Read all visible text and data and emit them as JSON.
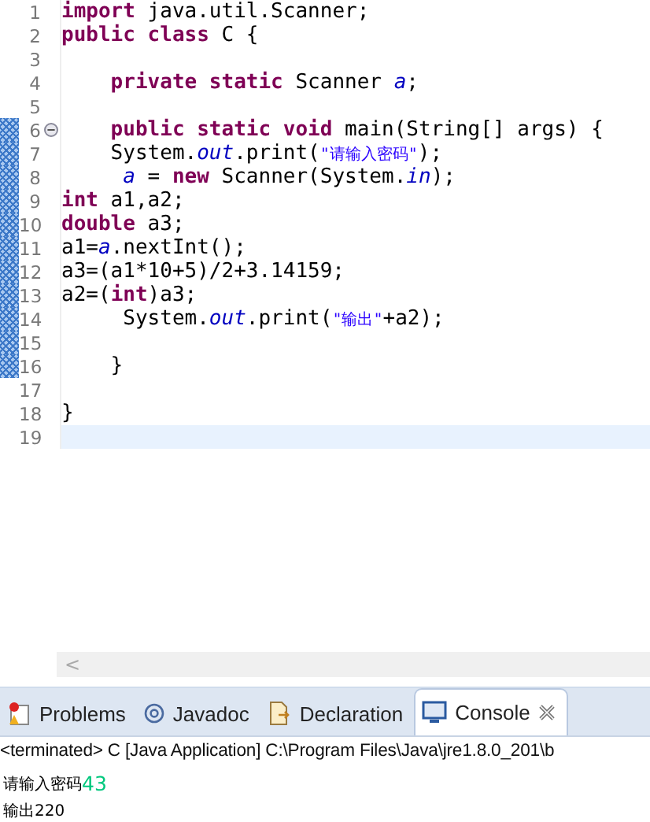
{
  "editor": {
    "lines": [
      {
        "number": "1",
        "marked": false,
        "foldable": false,
        "current": false,
        "tokens": [
          {
            "kind": "keyword",
            "text": "import"
          },
          {
            "kind": "plain",
            "text": " java.util.Scanner;"
          }
        ]
      },
      {
        "number": "2",
        "marked": false,
        "foldable": false,
        "current": false,
        "tokens": [
          {
            "kind": "keyword",
            "text": "public"
          },
          {
            "kind": "keyword",
            "text": " class"
          },
          {
            "kind": "plain",
            "text": " C {"
          }
        ]
      },
      {
        "number": "3",
        "marked": false,
        "foldable": false,
        "current": false
      },
      {
        "number": "4",
        "marked": false,
        "foldable": false,
        "current": false,
        "tokens": [
          {
            "kind": "keyword",
            "text": "    private"
          },
          {
            "kind": "keyword",
            "text": " static"
          },
          {
            "kind": "plain",
            "text": " Scanner "
          },
          {
            "kind": "field",
            "text": "a"
          },
          {
            "kind": "plain",
            "text": ";"
          }
        ]
      },
      {
        "number": "5",
        "marked": false,
        "foldable": false,
        "current": false
      },
      {
        "number": "6",
        "marked": true,
        "foldable": true,
        "current": false,
        "tokens": [
          {
            "kind": "keyword",
            "text": "    public"
          },
          {
            "kind": "keyword",
            "text": " static"
          },
          {
            "kind": "keyword",
            "text": " void"
          },
          {
            "kind": "plain",
            "text": " main(String[] args) {"
          }
        ]
      },
      {
        "number": "7",
        "marked": true,
        "foldable": false,
        "current": false,
        "tokens": [
          {
            "kind": "plain",
            "text": "    System."
          },
          {
            "kind": "field",
            "text": "out"
          },
          {
            "kind": "plain",
            "text": ".print("
          },
          {
            "kind": "string",
            "text": "\"请输入密码\""
          },
          {
            "kind": "plain",
            "text": ");"
          }
        ]
      },
      {
        "number": "8",
        "marked": true,
        "foldable": false,
        "current": false,
        "tokens": [
          {
            "kind": "field",
            "text": "     a"
          },
          {
            "kind": "plain",
            "text": " = "
          },
          {
            "kind": "keyword",
            "text": "new"
          },
          {
            "kind": "plain",
            "text": " Scanner(System."
          },
          {
            "kind": "field",
            "text": "in"
          },
          {
            "kind": "plain",
            "text": ");"
          }
        ]
      },
      {
        "number": "9",
        "marked": true,
        "foldable": false,
        "current": false,
        "tokens": [
          {
            "kind": "keyword",
            "text": "int"
          },
          {
            "kind": "plain",
            "text": " a1,a2;"
          }
        ]
      },
      {
        "number": "10",
        "marked": true,
        "foldable": false,
        "current": false,
        "tokens": [
          {
            "kind": "keyword",
            "text": "double"
          },
          {
            "kind": "plain",
            "text": " a3;"
          }
        ]
      },
      {
        "number": "11",
        "marked": true,
        "foldable": false,
        "current": false,
        "tokens": [
          {
            "kind": "plain",
            "text": "a1="
          },
          {
            "kind": "field",
            "text": "a"
          },
          {
            "kind": "plain",
            "text": ".nextInt();"
          }
        ]
      },
      {
        "number": "12",
        "marked": true,
        "foldable": false,
        "current": false,
        "tokens": [
          {
            "kind": "plain",
            "text": "a3=(a1*10+5)/2+3.14159;"
          }
        ]
      },
      {
        "number": "13",
        "marked": true,
        "foldable": false,
        "current": false,
        "tokens": [
          {
            "kind": "plain",
            "text": "a2=("
          },
          {
            "kind": "keyword",
            "text": "int"
          },
          {
            "kind": "plain",
            "text": ")a3;"
          }
        ]
      },
      {
        "number": "14",
        "marked": true,
        "foldable": false,
        "current": false,
        "tokens": [
          {
            "kind": "plain",
            "text": "     System."
          },
          {
            "kind": "field",
            "text": "out"
          },
          {
            "kind": "plain",
            "text": ".print("
          },
          {
            "kind": "string",
            "text": "\"输出\""
          },
          {
            "kind": "plain",
            "text": "+a2);"
          }
        ]
      },
      {
        "number": "15",
        "marked": true,
        "foldable": false,
        "current": false
      },
      {
        "number": "16",
        "marked": true,
        "foldable": false,
        "current": false,
        "tokens": [
          {
            "kind": "plain",
            "text": "    }"
          }
        ]
      },
      {
        "number": "17",
        "marked": false,
        "foldable": false,
        "current": false
      },
      {
        "number": "18",
        "marked": false,
        "foldable": false,
        "current": false,
        "tokens": [
          {
            "kind": "plain",
            "text": "}"
          }
        ]
      },
      {
        "number": "19",
        "marked": false,
        "foldable": false,
        "current": true
      }
    ],
    "scroll_left": "<"
  },
  "tabs": [
    {
      "label": "Problems",
      "kind": "problems",
      "selected": false
    },
    {
      "label": "Javadoc",
      "kind": "javadoc",
      "selected": false
    },
    {
      "label": "Declaration",
      "kind": "declaration",
      "selected": false
    },
    {
      "label": "Console",
      "kind": "console",
      "selected": true
    }
  ],
  "console": {
    "header": "<terminated> C [Java Application] C:\\Program Files\\Java\\jre1.8.0_201\\b",
    "output": [
      [
        {
          "kind": "output",
          "text": "请输入密码"
        },
        {
          "kind": "input",
          "text": "43"
        }
      ],
      [
        {
          "kind": "output",
          "text": "输出220"
        }
      ]
    ]
  }
}
